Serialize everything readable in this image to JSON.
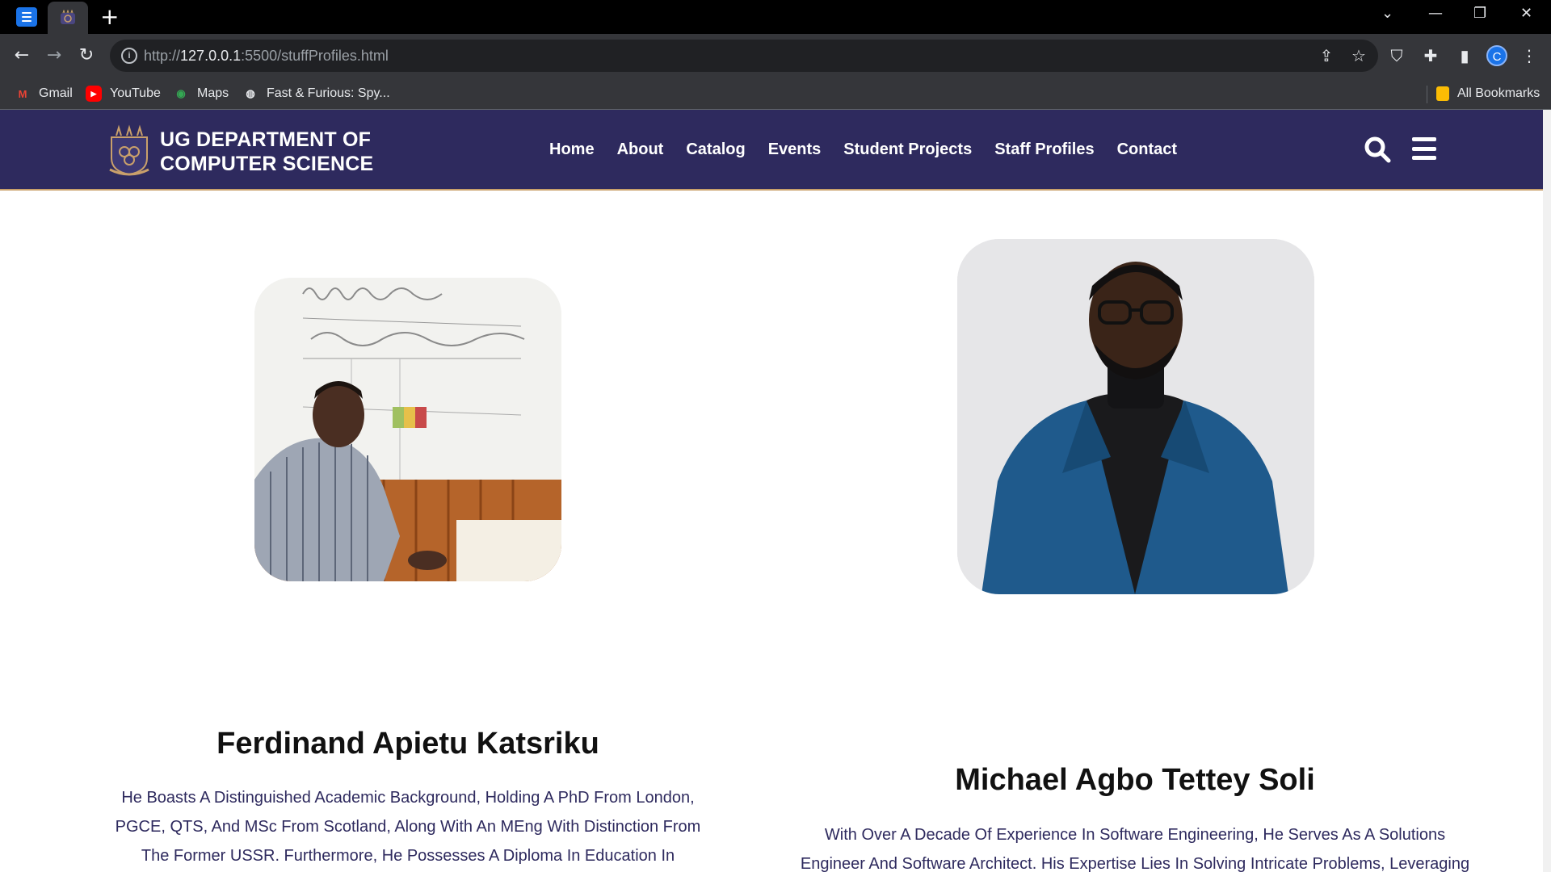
{
  "browser": {
    "url_prefix": "http://",
    "url_host": "127.0.0.1",
    "url_rest": ":5500/stuffProfiles.html",
    "new_tab_glyph": "+",
    "bookmarks": [
      {
        "label": "Gmail",
        "icon": "gmail-icon"
      },
      {
        "label": "YouTube",
        "icon": "youtube-icon"
      },
      {
        "label": "Maps",
        "icon": "maps-icon"
      },
      {
        "label": "Fast & Furious: Spy...",
        "icon": "globe-icon"
      }
    ],
    "all_bookmarks_label": "All Bookmarks",
    "profile_initial": "C"
  },
  "site": {
    "logo_line1": "UG DEPARTMENT OF",
    "logo_line2": "COMPUTER SCIENCE",
    "menu": [
      "Home",
      "About",
      "Catalog",
      "Events",
      "Student Projects",
      "Staff Profiles",
      "Contact"
    ]
  },
  "profiles": [
    {
      "name": "Ferdinand Apietu Katsriku",
      "bio": "He Boasts A Distinguished Academic Background, Holding A PhD From London, PGCE, QTS, And MSc From Scotland, Along With An MEng With Distinction From The Former USSR. Furthermore, He Possesses A Diploma In Education In"
    },
    {
      "name": "Michael Agbo Tettey Soli",
      "bio": "With Over A Decade Of Experience In Software Engineering, He Serves As A Solutions Engineer And Software Architect. His Expertise Lies In Solving Intricate Problems, Leveraging"
    }
  ],
  "colors": {
    "nav_bg": "#2e2a5e",
    "accent_border": "#c9a06b",
    "bio_text": "#2e2a5e"
  }
}
